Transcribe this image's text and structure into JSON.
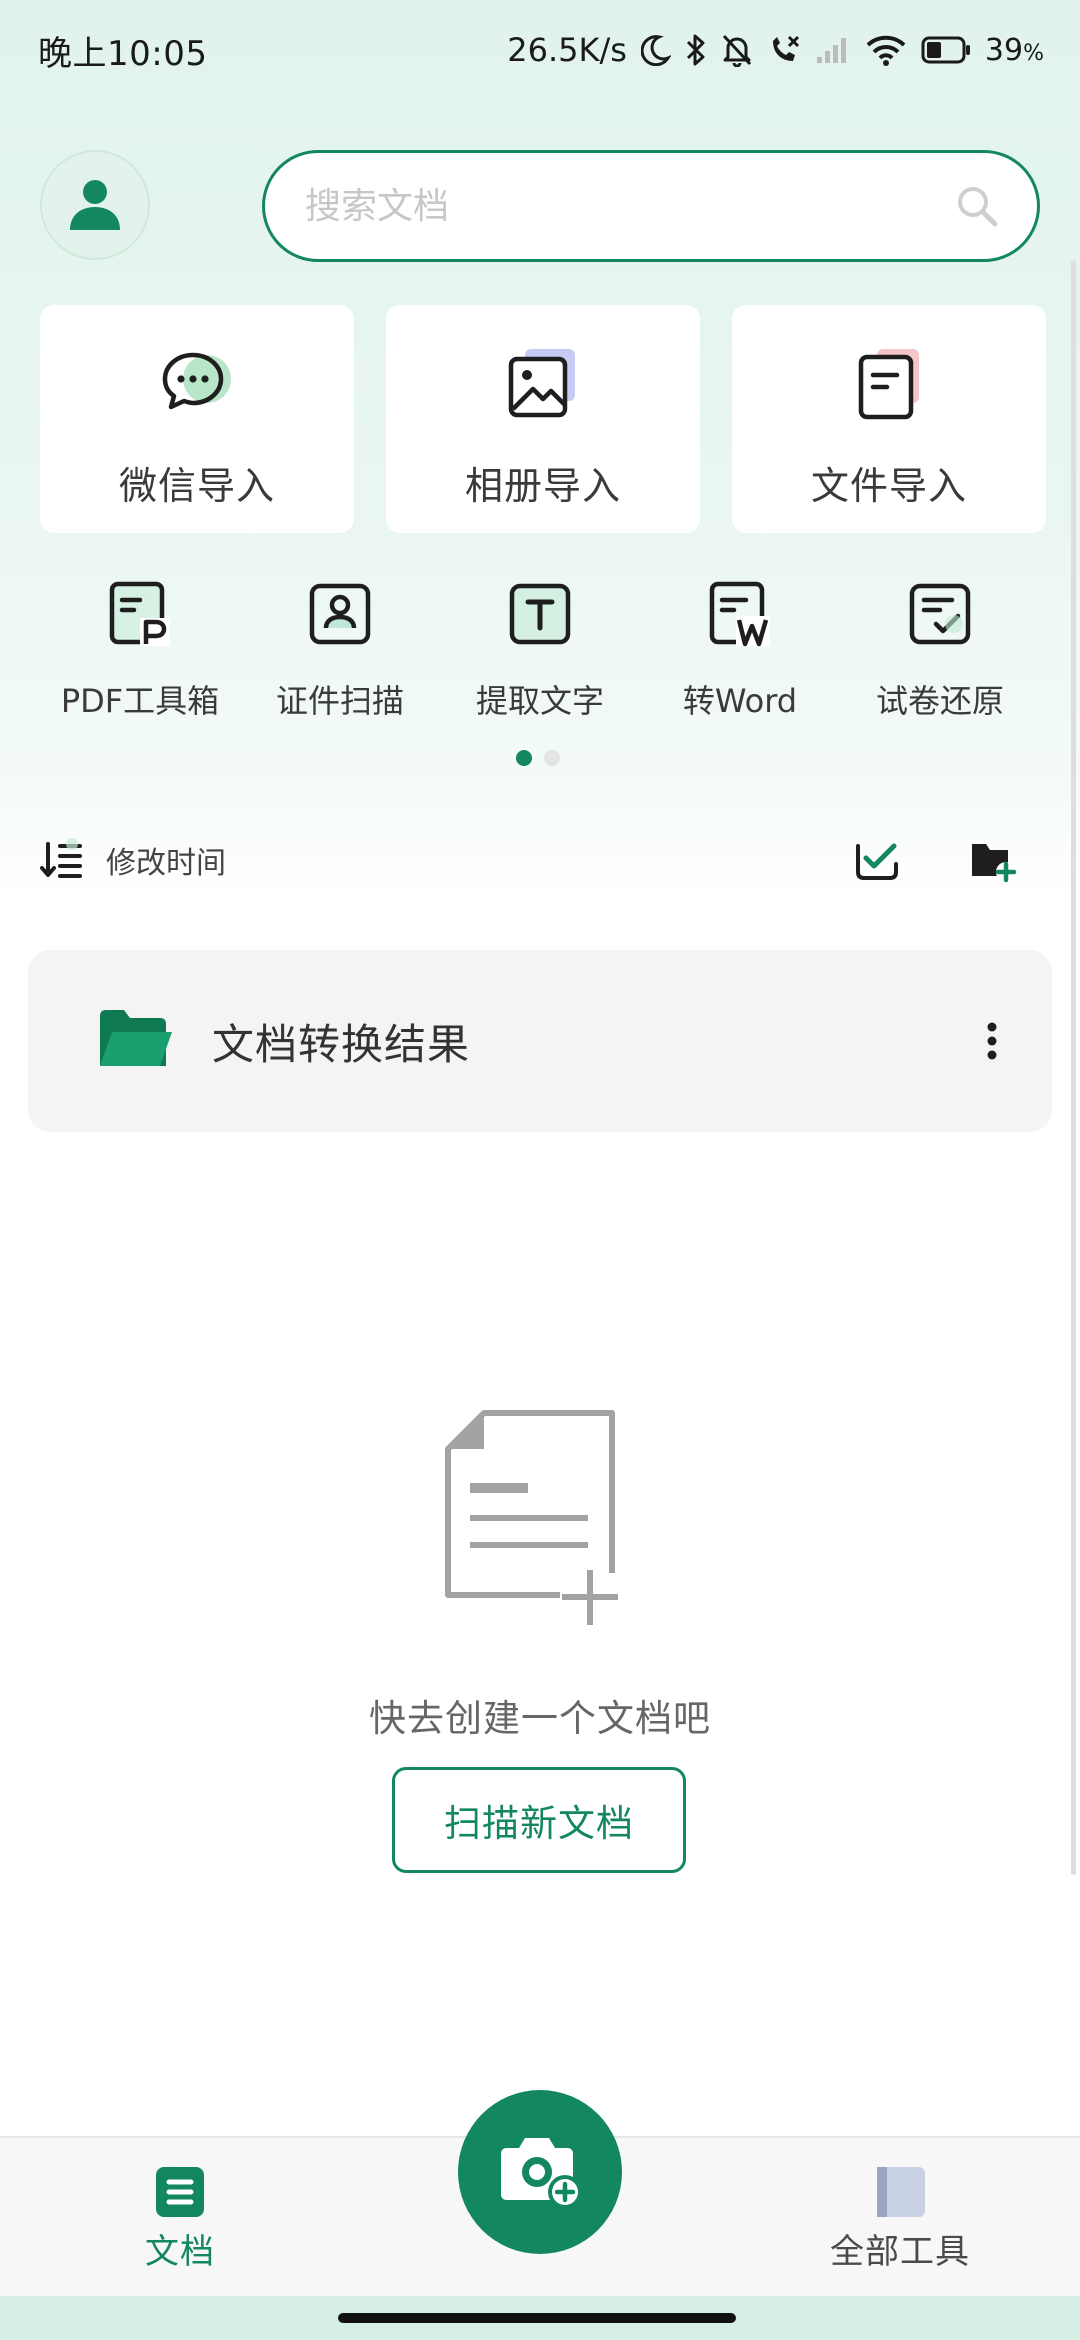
{
  "status_bar": {
    "time": "晚上10:05",
    "network_speed": "26.5K/s",
    "battery_percent": "39",
    "battery_unit": "%",
    "icons": [
      "moon-icon",
      "bluetooth-icon",
      "mute-icon",
      "call-missed-icon",
      "signal-icon",
      "wifi-icon",
      "battery-icon"
    ]
  },
  "header": {
    "avatar_icon": "user-icon",
    "search_placeholder": "搜索文档",
    "search_icon": "search-icon"
  },
  "import_cards": [
    {
      "label": "微信导入",
      "icon": "wechat-icon",
      "accent": "#b9e6c9"
    },
    {
      "label": "相册导入",
      "icon": "photo-album-icon",
      "accent": "#c5cbf2"
    },
    {
      "label": "文件导入",
      "icon": "file-icon",
      "accent": "#f6c6c6"
    }
  ],
  "tools": [
    {
      "label": "PDF工具箱",
      "icon": "pdf-toolbox-icon"
    },
    {
      "label": "证件扫描",
      "icon": "id-scan-icon"
    },
    {
      "label": "提取文字",
      "icon": "extract-text-icon"
    },
    {
      "label": "转Word",
      "icon": "to-word-icon"
    },
    {
      "label": "试卷还原",
      "icon": "exam-restore-icon"
    }
  ],
  "tools_pager": {
    "pages": 2,
    "active": 1
  },
  "sort": {
    "label": "修改时间",
    "icon": "sort-icon"
  },
  "list_actions": [
    "multi-select-icon",
    "new-folder-icon"
  ],
  "folders": [
    {
      "name": "文档转换结果",
      "icon": "folder-icon"
    }
  ],
  "empty_state": {
    "message": "快去创建一个文档吧",
    "button_label": "扫描新文档",
    "illustration": "new-document-icon"
  },
  "bottom_nav": {
    "items": [
      {
        "label": "文档",
        "icon": "documents-icon",
        "active": true
      },
      {
        "label": "全部工具",
        "icon": "all-tools-icon",
        "active": false
      }
    ],
    "fab_icon": "camera-add-icon"
  },
  "colors": {
    "brand": "#13875e",
    "background_top": "#e1f3ec",
    "card": "#ffffff",
    "folder_card": "#f4f4f4"
  }
}
